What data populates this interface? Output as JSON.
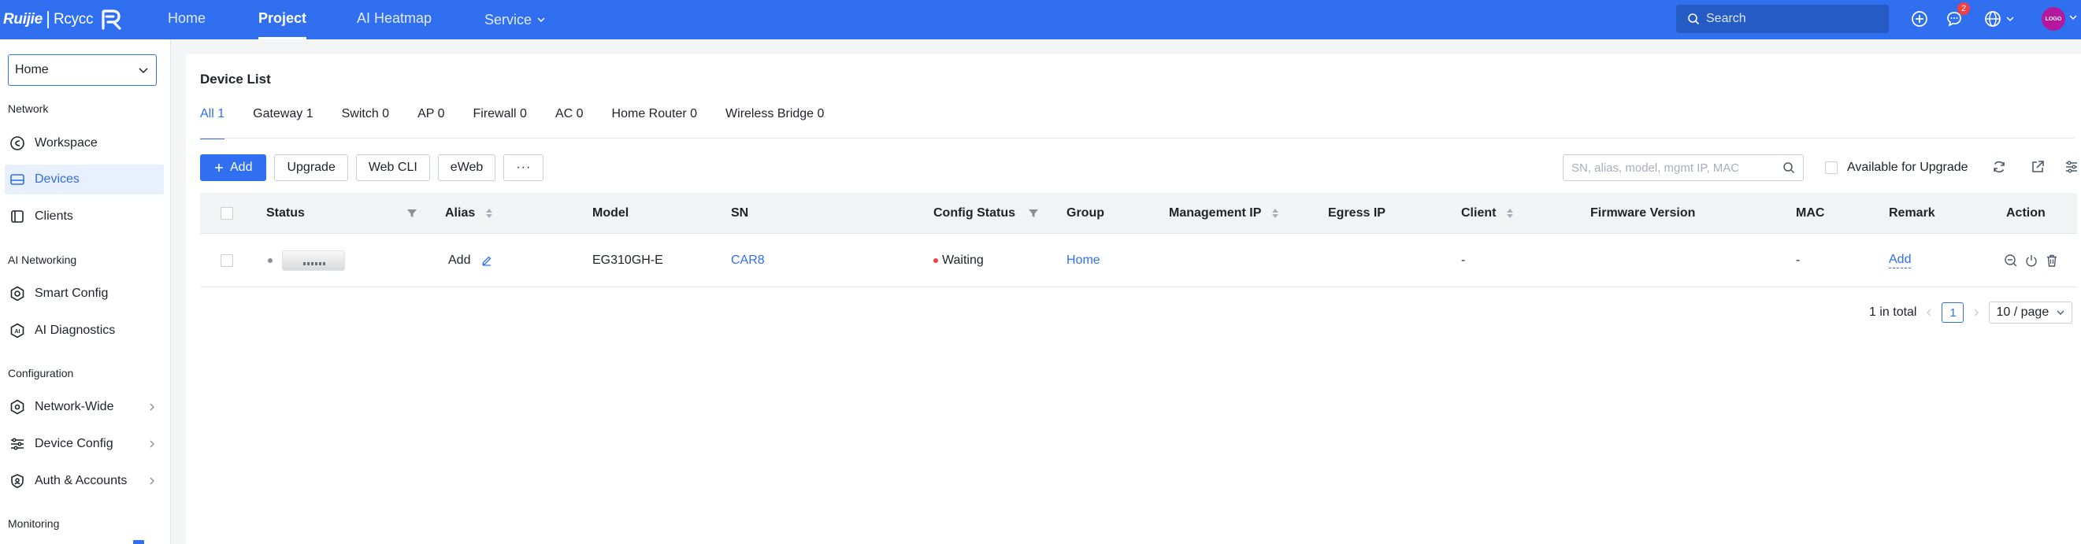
{
  "brand": {
    "name": "Ruijie",
    "product": "Rcycc"
  },
  "colors": {
    "primary": "#2f6ff0",
    "danger": "#f53f3f",
    "status_offline": "#8a8f98"
  },
  "topnav": {
    "items": [
      {
        "label": "Home"
      },
      {
        "label": "Project",
        "active": true
      },
      {
        "label": "AI Heatmap"
      },
      {
        "label": "Service"
      }
    ],
    "search_placeholder": "Search",
    "message_badge": "2",
    "avatar_text": "LOGO"
  },
  "sidebar": {
    "site": "Home",
    "sections": {
      "network": "Network",
      "ai_networking": "AI Networking",
      "configuration": "Configuration",
      "monitoring": "Monitoring"
    },
    "items": {
      "workspace": "Workspace",
      "devices": "Devices",
      "clients": "Clients",
      "smart_config": "Smart Config",
      "ai_diagnostics": "AI Diagnostics",
      "network_wide": "Network-Wide",
      "device_config": "Device Config",
      "auth_accounts": "Auth & Accounts"
    }
  },
  "main": {
    "title": "Device List",
    "tabs": [
      {
        "label": "All 1",
        "active": true
      },
      {
        "label": "Gateway 1"
      },
      {
        "label": "Switch 0"
      },
      {
        "label": "AP 0"
      },
      {
        "label": "Firewall 0"
      },
      {
        "label": "AC 0"
      },
      {
        "label": "Home Router 0"
      },
      {
        "label": "Wireless Bridge 0"
      }
    ],
    "toolbar": {
      "add": "Add",
      "upgrade": "Upgrade",
      "web_cli": "Web CLI",
      "eweb": "eWeb",
      "more": "···",
      "search_placeholder": "SN, alias, model, mgmt IP, MAC",
      "available_upgrade": "Available for Upgrade"
    },
    "table": {
      "columns": {
        "status": "Status",
        "alias": "Alias",
        "model": "Model",
        "sn": "SN",
        "config_status": "Config Status",
        "group": "Group",
        "management_ip": "Management IP",
        "egress_ip": "Egress IP",
        "client": "Client",
        "firmware": "Firmware Version",
        "mac": "MAC",
        "remark": "Remark",
        "action": "Action"
      },
      "rows": [
        {
          "alias": "Add",
          "model": "EG310GH-E",
          "sn": "CAR8",
          "config_status": "Waiting",
          "group": "Home",
          "management_ip": "",
          "egress_ip": "",
          "client": "-",
          "firmware": "",
          "mac": "-",
          "remark": "Add"
        }
      ]
    },
    "pagination": {
      "total": "1 in total",
      "current": "1",
      "page_size": "10 / page"
    }
  }
}
